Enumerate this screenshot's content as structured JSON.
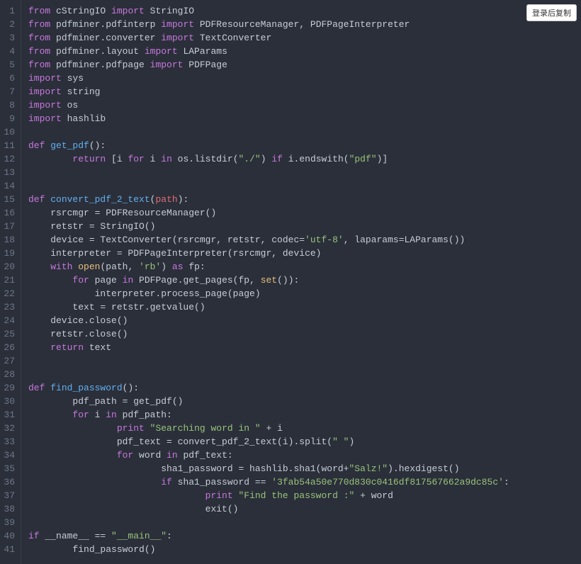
{
  "copy_button_label": "登录后复制",
  "line_count": 41,
  "code_lines": [
    [
      [
        "kw",
        "from"
      ],
      [
        "pl",
        " cStringIO "
      ],
      [
        "kw",
        "import"
      ],
      [
        "pl",
        " StringIO"
      ]
    ],
    [
      [
        "kw",
        "from"
      ],
      [
        "pl",
        " pdfminer.pdfinterp "
      ],
      [
        "kw",
        "import"
      ],
      [
        "pl",
        " PDFResourceManager, PDFPageInterpreter"
      ]
    ],
    [
      [
        "kw",
        "from"
      ],
      [
        "pl",
        " pdfminer.converter "
      ],
      [
        "kw",
        "import"
      ],
      [
        "pl",
        " TextConverter"
      ]
    ],
    [
      [
        "kw",
        "from"
      ],
      [
        "pl",
        " pdfminer.layout "
      ],
      [
        "kw",
        "import"
      ],
      [
        "pl",
        " LAParams"
      ]
    ],
    [
      [
        "kw",
        "from"
      ],
      [
        "pl",
        " pdfminer.pdfpage "
      ],
      [
        "kw",
        "import"
      ],
      [
        "pl",
        " PDFPage"
      ]
    ],
    [
      [
        "kw",
        "import"
      ],
      [
        "pl",
        " sys"
      ]
    ],
    [
      [
        "kw",
        "import"
      ],
      [
        "pl",
        " string"
      ]
    ],
    [
      [
        "kw",
        "import"
      ],
      [
        "pl",
        " os"
      ]
    ],
    [
      [
        "kw",
        "import"
      ],
      [
        "pl",
        " hashlib"
      ]
    ],
    [],
    [
      [
        "kw",
        "def"
      ],
      [
        "pl",
        " "
      ],
      [
        "fn",
        "get_pdf"
      ],
      [
        "pl",
        "():"
      ]
    ],
    [
      [
        "pl",
        "        "
      ],
      [
        "kw",
        "return"
      ],
      [
        "pl",
        " [i "
      ],
      [
        "kw",
        "for"
      ],
      [
        "pl",
        " i "
      ],
      [
        "kw",
        "in"
      ],
      [
        "pl",
        " os.listdir("
      ],
      [
        "str",
        "\"./\""
      ],
      [
        "pl",
        ") "
      ],
      [
        "kw",
        "if"
      ],
      [
        "pl",
        " i.endswith("
      ],
      [
        "str",
        "\"pdf\""
      ],
      [
        "pl",
        ")]"
      ]
    ],
    [],
    [],
    [
      [
        "kw",
        "def"
      ],
      [
        "pl",
        " "
      ],
      [
        "fn",
        "convert_pdf_2_text"
      ],
      [
        "pl",
        "("
      ],
      [
        "prm",
        "path"
      ],
      [
        "pl",
        "):"
      ]
    ],
    [
      [
        "pl",
        "    rsrcmgr = PDFResourceManager()"
      ]
    ],
    [
      [
        "pl",
        "    retstr = StringIO()"
      ]
    ],
    [
      [
        "pl",
        "    device = TextConverter(rsrcmgr, retstr, codec="
      ],
      [
        "str",
        "'utf-8'"
      ],
      [
        "pl",
        ", laparams=LAParams())"
      ]
    ],
    [
      [
        "pl",
        "    interpreter = PDFPageInterpreter(rsrcmgr, device)"
      ]
    ],
    [
      [
        "pl",
        "    "
      ],
      [
        "kw",
        "with"
      ],
      [
        "pl",
        " "
      ],
      [
        "bi",
        "open"
      ],
      [
        "pl",
        "(path, "
      ],
      [
        "str",
        "'rb'"
      ],
      [
        "pl",
        ") "
      ],
      [
        "kw",
        "as"
      ],
      [
        "pl",
        " fp:"
      ]
    ],
    [
      [
        "pl",
        "        "
      ],
      [
        "kw",
        "for"
      ],
      [
        "pl",
        " page "
      ],
      [
        "kw",
        "in"
      ],
      [
        "pl",
        " PDFPage.get_pages(fp, "
      ],
      [
        "bi",
        "set"
      ],
      [
        "pl",
        "()):"
      ]
    ],
    [
      [
        "pl",
        "            interpreter.process_page(page)"
      ]
    ],
    [
      [
        "pl",
        "        text = retstr.getvalue()"
      ]
    ],
    [
      [
        "pl",
        "    device.close()"
      ]
    ],
    [
      [
        "pl",
        "    retstr.close()"
      ]
    ],
    [
      [
        "pl",
        "    "
      ],
      [
        "kw",
        "return"
      ],
      [
        "pl",
        " text"
      ]
    ],
    [],
    [],
    [
      [
        "kw",
        "def"
      ],
      [
        "pl",
        " "
      ],
      [
        "fn",
        "find_password"
      ],
      [
        "pl",
        "():"
      ]
    ],
    [
      [
        "pl",
        "        pdf_path = get_pdf()"
      ]
    ],
    [
      [
        "pl",
        "        "
      ],
      [
        "kw",
        "for"
      ],
      [
        "pl",
        " i "
      ],
      [
        "kw",
        "in"
      ],
      [
        "pl",
        " pdf_path:"
      ]
    ],
    [
      [
        "pl",
        "                "
      ],
      [
        "kw",
        "print"
      ],
      [
        "pl",
        " "
      ],
      [
        "str",
        "\"Searching word in \""
      ],
      [
        "pl",
        " + i"
      ]
    ],
    [
      [
        "pl",
        "                pdf_text = convert_pdf_2_text(i).split("
      ],
      [
        "str",
        "\" \""
      ],
      [
        "pl",
        ")"
      ]
    ],
    [
      [
        "pl",
        "                "
      ],
      [
        "kw",
        "for"
      ],
      [
        "pl",
        " word "
      ],
      [
        "kw",
        "in"
      ],
      [
        "pl",
        " pdf_text:"
      ]
    ],
    [
      [
        "pl",
        "                        sha1_password = hashlib.sha1(word+"
      ],
      [
        "str",
        "\"Salz!\""
      ],
      [
        "pl",
        ").hexdigest()"
      ]
    ],
    [
      [
        "pl",
        "                        "
      ],
      [
        "kw",
        "if"
      ],
      [
        "pl",
        " sha1_password == "
      ],
      [
        "str",
        "'3fab54a50e770d830c0416df817567662a9dc85c'"
      ],
      [
        "pl",
        ":"
      ]
    ],
    [
      [
        "pl",
        "                                "
      ],
      [
        "kw",
        "print"
      ],
      [
        "pl",
        " "
      ],
      [
        "str",
        "\"Find the password :\""
      ],
      [
        "pl",
        " + word"
      ]
    ],
    [
      [
        "pl",
        "                                exit()"
      ]
    ],
    [],
    [
      [
        "kw",
        "if"
      ],
      [
        "pl",
        " __name__ == "
      ],
      [
        "str",
        "\"__main__\""
      ],
      [
        "pl",
        ":"
      ]
    ],
    [
      [
        "pl",
        "        find_password()"
      ]
    ]
  ]
}
